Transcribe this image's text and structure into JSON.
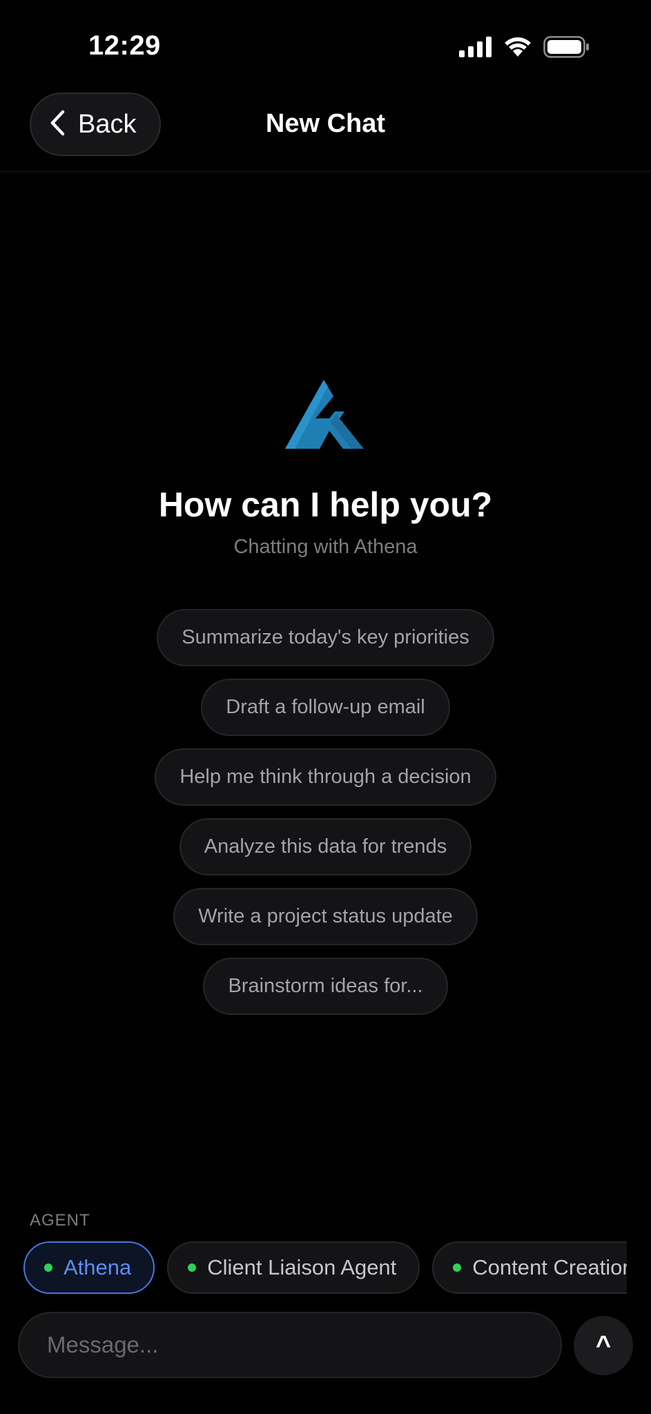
{
  "status_bar": {
    "time": "12:29",
    "icons": [
      "cellular-signal-icon",
      "wifi-icon",
      "battery-icon"
    ]
  },
  "header": {
    "back_label": "Back",
    "title": "New Chat"
  },
  "hero": {
    "logo": "athena-logo",
    "title": "How can I help you?",
    "subtitle": "Chatting with Athena"
  },
  "suggestions": [
    "Summarize today's key priorities",
    "Draft a follow-up email",
    "Help me think through a decision",
    "Analyze this data for trends",
    "Write a project status update",
    "Brainstorm ideas for..."
  ],
  "agents": {
    "label": "AGENT",
    "items": [
      {
        "name": "Athena",
        "active": true
      },
      {
        "name": "Client Liaison Agent",
        "active": false
      },
      {
        "name": "Content Creation Agent",
        "active": false
      }
    ]
  },
  "composer": {
    "placeholder": "Message...",
    "send_symbol": "^"
  },
  "colors": {
    "background": "#000000",
    "accent": "#5b8ef0",
    "online": "#30d158",
    "logo": "#1f7fb5"
  }
}
